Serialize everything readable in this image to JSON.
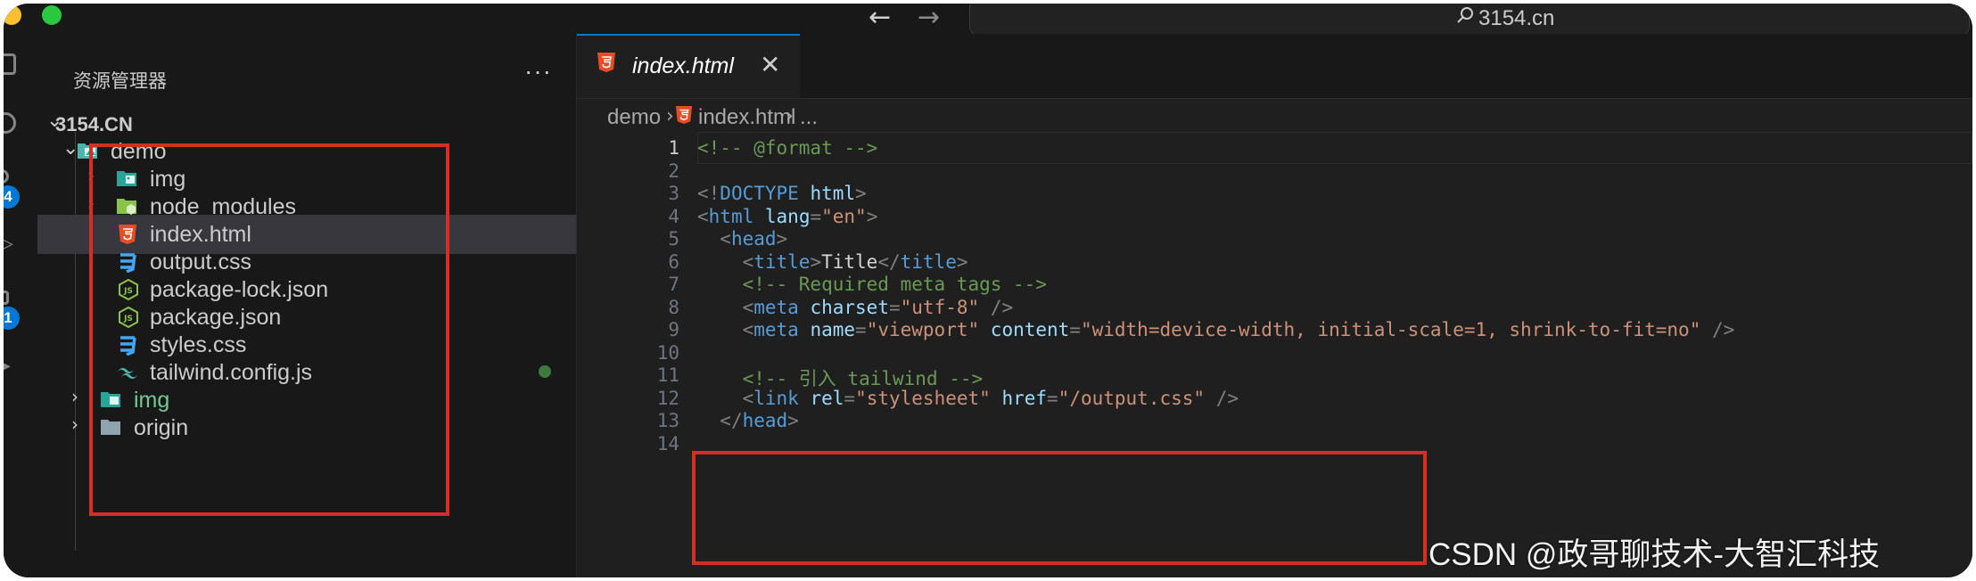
{
  "titlebar": {
    "search_text": "3154.cn"
  },
  "activitybar": {
    "badges": [
      "4",
      "1"
    ]
  },
  "sidebar": {
    "title": "资源管理器",
    "more": "···",
    "root": "3154.CN",
    "items": [
      {
        "label": "demo",
        "icon": "folder-open-icon",
        "expanded": true
      },
      {
        "label": "img",
        "icon": "image-folder-icon"
      },
      {
        "label": "node_modules",
        "icon": "node-folder-icon"
      },
      {
        "label": "index.html",
        "icon": "html-file-icon",
        "selected": true
      },
      {
        "label": "output.css",
        "icon": "css-file-icon"
      },
      {
        "label": "package-lock.json",
        "icon": "js-file-icon"
      },
      {
        "label": "package.json",
        "icon": "js-file-icon"
      },
      {
        "label": "styles.css",
        "icon": "css-file-icon"
      },
      {
        "label": "tailwind.config.js",
        "icon": "tailwind-file-icon"
      },
      {
        "label": "img",
        "icon": "image-folder-icon"
      },
      {
        "label": "origin",
        "icon": "folder-icon"
      }
    ]
  },
  "editor": {
    "tab_label": "index.html",
    "tab_close": "✕",
    "breadcrumb": [
      "demo",
      "index.html",
      "..."
    ],
    "lines": [
      {
        "n": "1",
        "text": "<!-- @format -->"
      },
      {
        "n": "2",
        "text": ""
      },
      {
        "n": "3",
        "text": "<!DOCTYPE html>"
      },
      {
        "n": "4",
        "text": "<html lang=\"en\">"
      },
      {
        "n": "5",
        "text": "  <head>"
      },
      {
        "n": "6",
        "text": "    <title>Title</title>"
      },
      {
        "n": "7",
        "text": "    <!-- Required meta tags -->"
      },
      {
        "n": "8",
        "text": "    <meta charset=\"utf-8\" />"
      },
      {
        "n": "9",
        "text": "    <meta name=\"viewport\" content=\"width=device-width, initial-scale=1, shrink-to-fit=no\" />"
      },
      {
        "n": "10",
        "text": ""
      },
      {
        "n": "11",
        "text": "    <!-- 引入 tailwind -->"
      },
      {
        "n": "12",
        "text": "    <link rel=\"stylesheet\" href=\"/output.css\" />"
      },
      {
        "n": "13",
        "text": "  </head>"
      },
      {
        "n": "14",
        "text": ""
      }
    ]
  },
  "watermark": "CSDN @政哥聊技术-大智汇科技",
  "colors": {
    "highlight_box": "#d42e25",
    "accent": "#0078d4",
    "html_icon": "#e44d26",
    "css_icon": "#42a5f5",
    "js_icon": "#8bc34a"
  }
}
